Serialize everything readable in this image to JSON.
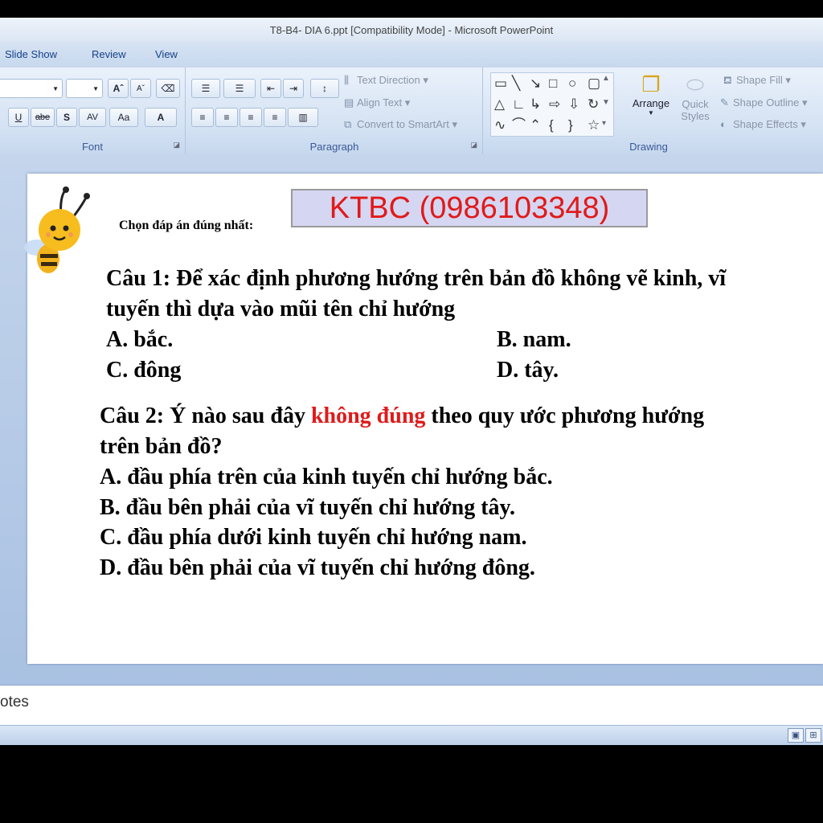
{
  "window": {
    "title": "T8-B4- DIA 6.ppt [Compatibility Mode] - Microsoft PowerPoint"
  },
  "tabs": [
    "Slide Show",
    "Review",
    "View"
  ],
  "ribbon": {
    "font": {
      "label": "Font",
      "grow_label": "Aˆ",
      "shrink_label": "Aˇ",
      "underline": "U",
      "strikethrough": "abe",
      "shadow": "S",
      "spacing": "AV",
      "change_case": "Aa",
      "font_color": "A"
    },
    "paragraph": {
      "label": "Paragraph",
      "text_direction": "Text Direction",
      "align_text": "Align Text",
      "convert_smartart": "Convert to SmartArt"
    },
    "drawing": {
      "label": "Drawing",
      "arrange": "Arrange",
      "quick_styles_1": "Quick",
      "quick_styles_2": "Styles",
      "shape_fill": "Shape Fill",
      "shape_outline": "Shape Outline",
      "shape_effects": "Shape Effects"
    }
  },
  "slide": {
    "instruction": "Chọn đáp án đúng nhất:",
    "banner": "KTBC (0986103348)",
    "q1": {
      "line1": "Câu 1: Để xác định phương hướng trên bản đồ không vẽ  kinh, vĩ",
      "line2": "tuyến thì dựa vào mũi tên chỉ hướng",
      "a": "A. bắc.",
      "b": "B. nam.",
      "c": "C. đông",
      "d": "D. tây."
    },
    "q2": {
      "prefix": "Câu 2: Ý nào sau đây ",
      "highlight": "không đúng",
      "suffix": " theo quy ước phương hướng",
      "line2": "trên bản đồ?",
      "a": "A. đầu phía trên của kinh tuyến chỉ hướng bắc.",
      "b": "B. đầu bên phải của vĩ tuyến chỉ hướng tây.",
      "c": "C. đầu phía dưới kinh tuyến chỉ hướng nam.",
      "d": "D. đầu bên phải của vĩ tuyến chỉ hướng đông."
    }
  },
  "notes": {
    "placeholder": "otes"
  },
  "colors": {
    "highlight_red": "#e01a1a",
    "banner_bg": "#d5d6f1"
  }
}
